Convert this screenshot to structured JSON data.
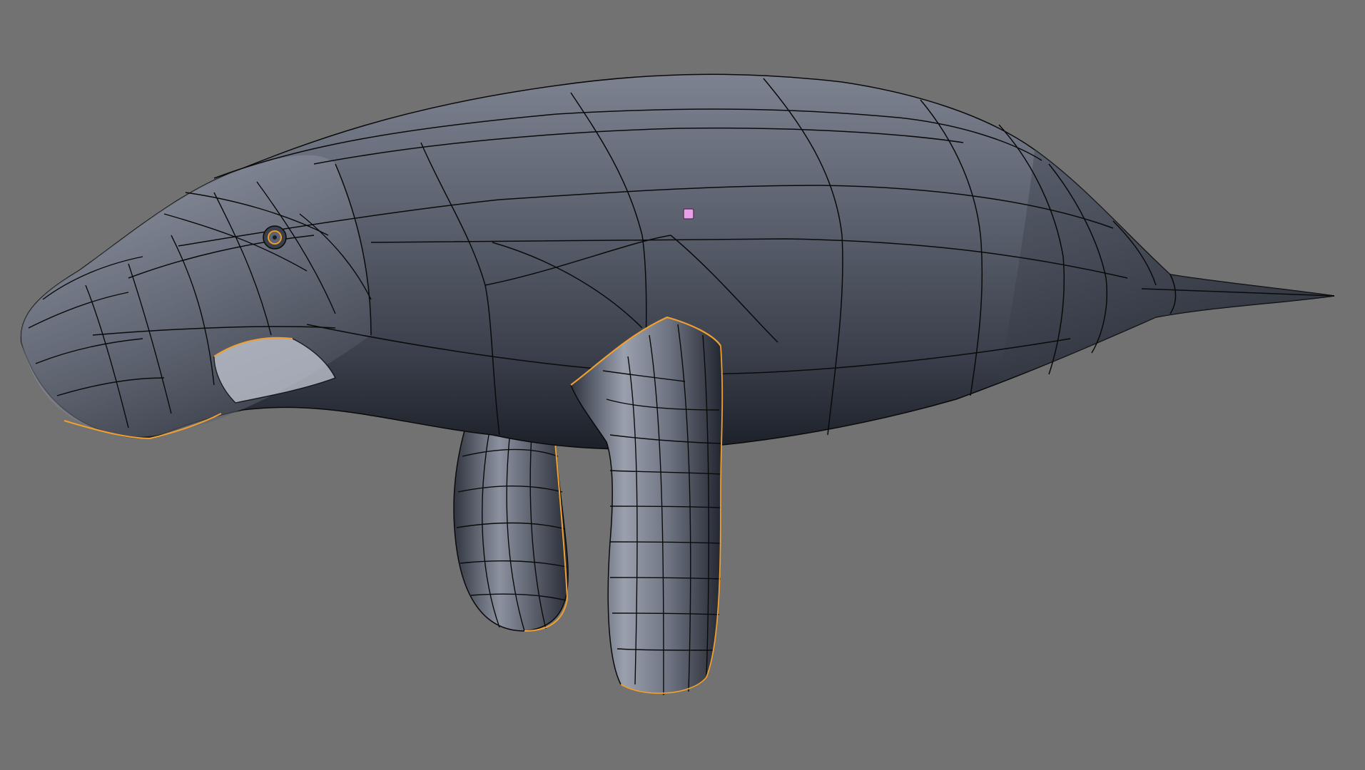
{
  "viewport": {
    "background_color": "#727272",
    "object": "manatee-mesh",
    "shading": "solid",
    "wireframe_overlay": true,
    "selected_edge_color": "#f0a030",
    "origin_marker_color": "#e7a0e8"
  },
  "mesh": {
    "body_color": "#5a606d",
    "body_dark_color": "#262a33",
    "body_light_color": "#aeb4c2",
    "edge_color": "#0a0a0a"
  }
}
